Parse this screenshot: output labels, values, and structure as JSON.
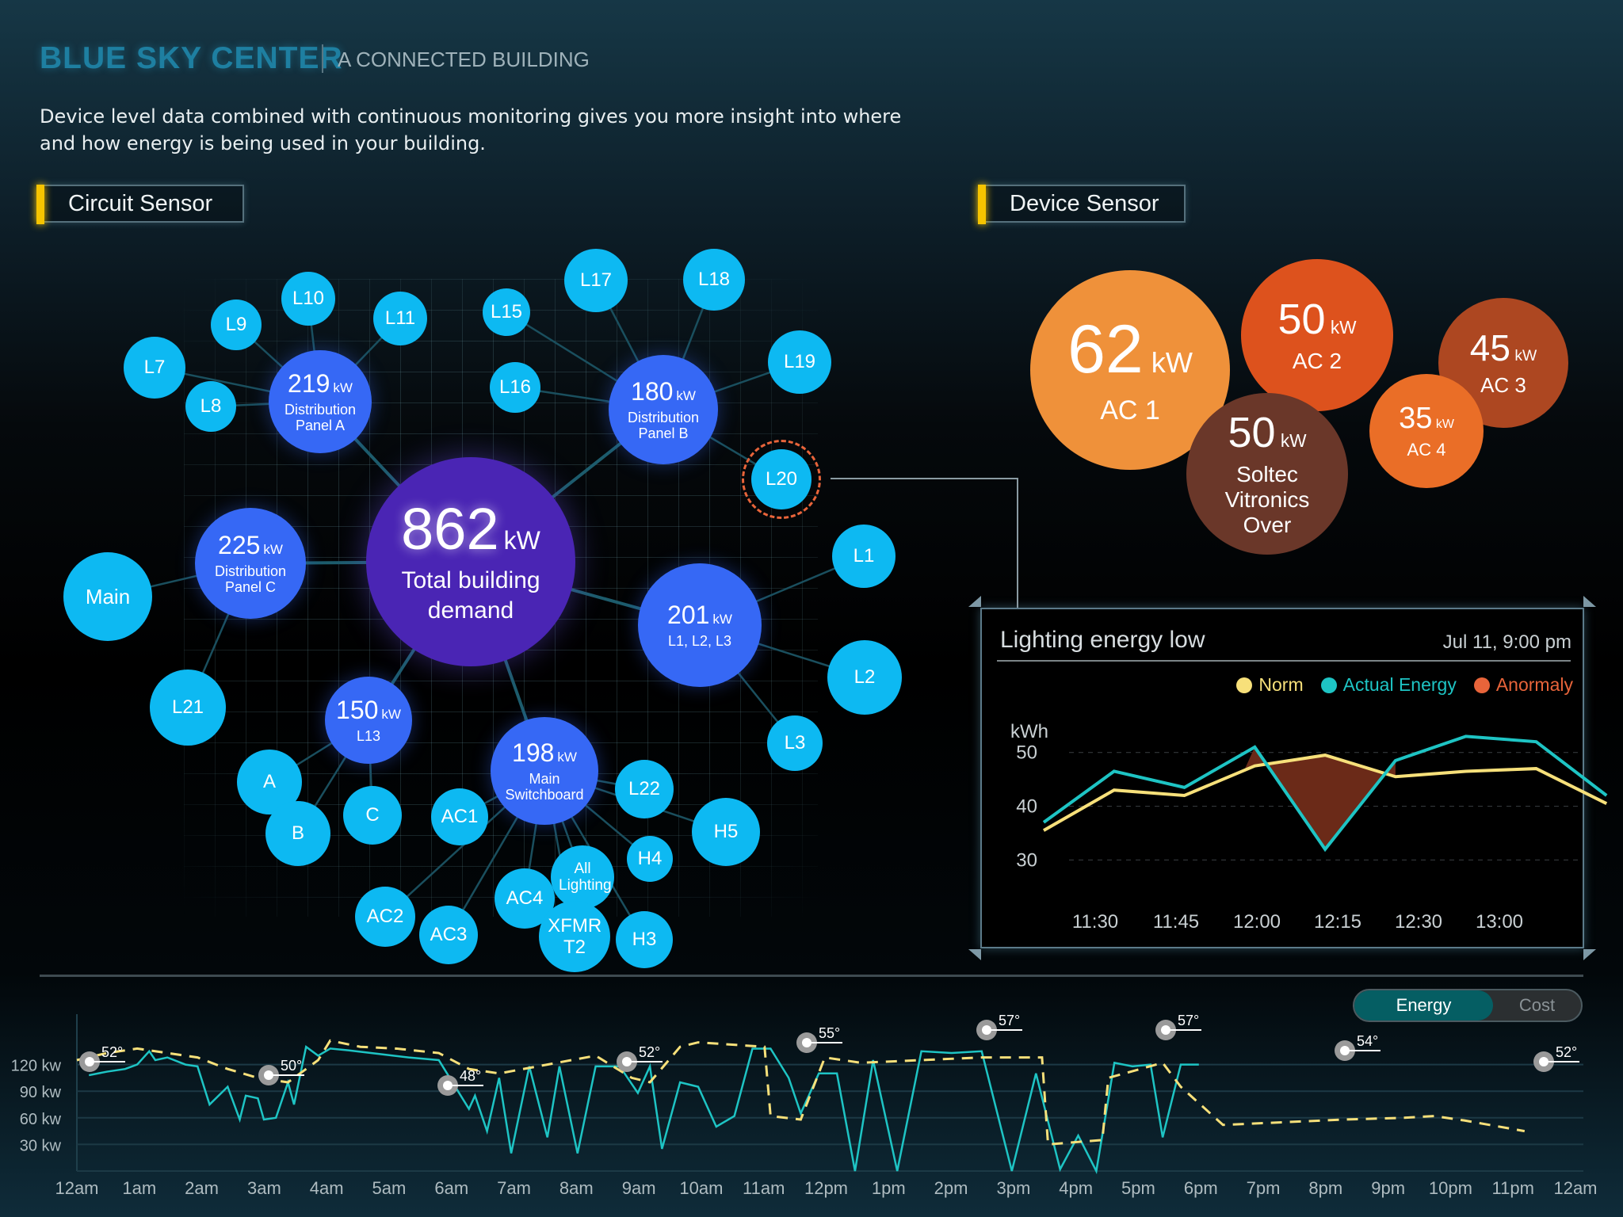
{
  "header": {
    "brand": "BLUE SKY CENTER",
    "subtitle": "A CONNECTED BUILDING",
    "description": "Device level data combined with continuous monitoring gives you more insight into where and how energy is being used in your building."
  },
  "sections": {
    "circuit_sensor": "Circuit Sensor",
    "device_sensor": "Device Sensor"
  },
  "circuit_network": {
    "total": {
      "value": "862",
      "unit": "kW",
      "label": "Total building demand"
    },
    "panels": [
      {
        "id": "panel-a",
        "value": "219",
        "unit": "kW",
        "label": "Distribution Panel A"
      },
      {
        "id": "panel-b",
        "value": "180",
        "unit": "kW",
        "label": "Distribution Panel B"
      },
      {
        "id": "panel-c",
        "value": "225",
        "unit": "kW",
        "label": "Distribution Panel C"
      },
      {
        "id": "l1-l2-l3",
        "value": "201",
        "unit": "kW",
        "label": "L1, L2, L3"
      },
      {
        "id": "l13",
        "value": "150",
        "unit": "kW",
        "label": "L13"
      },
      {
        "id": "main-switchboard",
        "value": "198",
        "unit": "kW",
        "label": "Main Switchboard"
      }
    ],
    "leaves": [
      "L7",
      "L8",
      "L9",
      "L10",
      "L11",
      "L15",
      "L16",
      "L17",
      "L18",
      "L19",
      "L20",
      "Main",
      "L1",
      "L2",
      "L3",
      "L21",
      "A",
      "B",
      "C",
      "AC1",
      "AC2",
      "AC3",
      "AC4",
      "All Lighting",
      "XFMR T2",
      "L22",
      "H3",
      "H4",
      "H5"
    ],
    "highlighted_leaf": "L20",
    "anomaly_color": "#e8643a"
  },
  "device_sensor": {
    "devices": [
      {
        "value": "62",
        "unit": "kW",
        "label": "AC 1",
        "color": "#ef913a"
      },
      {
        "value": "50",
        "unit": "kW",
        "label": "AC 2",
        "color": "#dd521d"
      },
      {
        "value": "45",
        "unit": "kW",
        "label": "AC 3",
        "color": "#ad4721"
      },
      {
        "value": "35",
        "unit": "kW",
        "label": "AC 4",
        "color": "#ea6e27"
      },
      {
        "value": "50",
        "unit": "kW",
        "label": "Soltec Vitronics Over",
        "color": "#6a3729"
      }
    ]
  },
  "alert_panel": {
    "title": "Lighting energy low",
    "timestamp": "Jul 11, 9:00 pm"
  },
  "chart_data": [
    {
      "type": "line",
      "title": "Lighting energy low",
      "ylabel": "kWh",
      "xlabel": "",
      "ylim": [
        28,
        56
      ],
      "yticks": [
        30,
        40,
        50
      ],
      "x_tick_labels": [
        "11:30",
        "11:45",
        "12:00",
        "12:15",
        "12:30",
        "13:00"
      ],
      "grid": true,
      "legend": "top-right",
      "series": [
        {
          "name": "Norm",
          "color": "#f7e07a",
          "values": [
            35.5,
            43,
            42,
            47.5,
            49.5,
            45.5,
            46.5,
            47,
            40.5
          ]
        },
        {
          "name": "Actual Energy",
          "color": "#1ec4c4",
          "values": [
            37,
            46.5,
            43.5,
            51,
            32,
            48.5,
            53,
            52,
            42
          ]
        }
      ],
      "anomaly": {
        "name": "Anormaly",
        "color": "#e8643a",
        "fill": "#6b2a18",
        "point_range": [
          3,
          5
        ]
      }
    },
    {
      "type": "line",
      "title": "",
      "ylabel": "",
      "xlabel": "",
      "ylim": [
        0,
        150
      ],
      "yticks": [
        30,
        60,
        90,
        120
      ],
      "ytick_labels": [
        "30 kw",
        "60 kw",
        "90 kw",
        "120 kw"
      ],
      "x_tick_labels": [
        "12am",
        "1am",
        "2am",
        "3am",
        "4am",
        "5am",
        "6am",
        "7am",
        "8am",
        "9am",
        "10am",
        "11am",
        "12pm",
        "1pm",
        "2pm",
        "3pm",
        "4pm",
        "5pm",
        "6pm",
        "7pm",
        "8pm",
        "9pm",
        "10pm",
        "11pm",
        "12am"
      ],
      "grid": true,
      "series": [
        {
          "name": "Actual",
          "color": "#1ec4c4",
          "style": "solid",
          "x_hours": [
            0.2,
            0.5,
            0.8,
            1.0,
            1.2,
            1.3,
            1.5,
            1.8,
            2.0,
            2.2,
            2.5,
            2.7,
            2.8,
            3.0,
            3.1,
            3.3,
            3.5,
            3.6,
            3.8,
            4.0,
            4.2,
            4.5,
            5.0,
            5.5,
            6.0,
            6.5,
            6.6,
            6.8,
            7.0,
            7.2,
            7.5,
            7.8,
            8.0,
            8.3,
            8.6,
            9.0,
            9.3,
            9.5,
            9.7,
            10.0,
            10.3,
            10.6,
            10.9,
            11.2,
            11.5,
            11.8,
            12.0,
            12.3,
            12.6,
            12.9,
            13.2,
            13.6,
            14.0,
            14.5,
            15.0,
            15.5,
            15.9,
            16.3,
            16.6,
            16.9,
            17.2,
            17.5,
            17.8,
            18.0,
            18.3,
            18.6
          ],
          "values": [
            108,
            112,
            115,
            120,
            135,
            125,
            128,
            120,
            118,
            75,
            95,
            58,
            85,
            82,
            58,
            60,
            100,
            75,
            140,
            130,
            138,
            136,
            132,
            128,
            125,
            70,
            85,
            45,
            105,
            20,
            118,
            38,
            118,
            20,
            118,
            118,
            88,
            118,
            25,
            100,
            95,
            50,
            62,
            138,
            138,
            105,
            65,
            110,
            110,
            0,
            125,
            0,
            135,
            133,
            135,
            0,
            110,
            2,
            40,
            0,
            122,
            118,
            120,
            38,
            120,
            120
          ]
        },
        {
          "name": "Norm",
          "color": "#f7e07a",
          "style": "dashed",
          "x_hours": [
            0,
            0.5,
            1.0,
            1.5,
            2.0,
            2.5,
            3.0,
            3.5,
            4.0,
            4.2,
            4.7,
            5.3,
            6.0,
            6.5,
            7.0,
            7.8,
            8.6,
            9.2,
            9.5,
            10.0,
            10.3,
            11.4,
            11.5,
            12.0,
            12.4,
            13.0,
            14.0,
            15.0,
            16.0,
            16.1,
            17.0,
            17.1,
            18.0,
            18.3,
            19.0,
            20.0,
            21.0,
            22.0,
            22.5,
            23.0,
            24.0
          ],
          "values": [
            125,
            133,
            138,
            133,
            128,
            115,
            105,
            100,
            125,
            147,
            140,
            138,
            133,
            115,
            110,
            120,
            130,
            105,
            100,
            140,
            145,
            140,
            62,
            58,
            128,
            122,
            125,
            128,
            128,
            30,
            35,
            105,
            122,
            95,
            52,
            55,
            58,
            60,
            62,
            57,
            45
          ]
        }
      ],
      "temperature_markers": [
        {
          "hour": 0.2,
          "label": "52°"
        },
        {
          "hour": 3.3,
          "label": "50°"
        },
        {
          "hour": 6.4,
          "label": "48°"
        },
        {
          "hour": 9.6,
          "label": "52°"
        },
        {
          "hour": 12.6,
          "label": "55°"
        },
        {
          "hour": 15.7,
          "label": "57°"
        },
        {
          "hour": 18.8,
          "label": "57°"
        },
        {
          "hour": 21.9,
          "label": "54°"
        },
        {
          "hour": 25.0,
          "label": "52°"
        }
      ]
    }
  ],
  "bottom_toggle": {
    "options": [
      "Energy",
      "Cost"
    ],
    "selected": "Energy"
  },
  "legend": {
    "norm": "Norm",
    "actual": "Actual Energy",
    "anomaly": "Anormaly"
  }
}
